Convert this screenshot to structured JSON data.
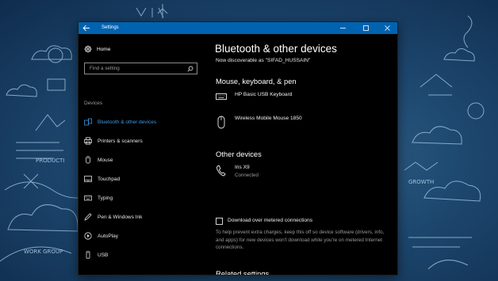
{
  "window": {
    "title": "Settings",
    "back_icon": "back-arrow-icon",
    "controls": [
      "minimize-icon",
      "maximize-icon",
      "close-icon"
    ],
    "accent_color": "#0063b1"
  },
  "sidebar": {
    "home_label": "Home",
    "search_placeholder": "Find a setting",
    "section_label": "Devices",
    "items": [
      {
        "label": "Bluetooth & other devices",
        "icon": "bluetooth-devices-icon",
        "active": true
      },
      {
        "label": "Printers & scanners",
        "icon": "printer-icon",
        "active": false
      },
      {
        "label": "Mouse",
        "icon": "mouse-icon",
        "active": false
      },
      {
        "label": "Touchpad",
        "icon": "touchpad-icon",
        "active": false
      },
      {
        "label": "Typing",
        "icon": "keyboard-icon",
        "active": false
      },
      {
        "label": "Pen & Windows Ink",
        "icon": "pen-icon",
        "active": false
      },
      {
        "label": "AutoPlay",
        "icon": "autoplay-icon",
        "active": false
      },
      {
        "label": "USB",
        "icon": "usb-icon",
        "active": false
      }
    ],
    "active_color": "#3e98e0"
  },
  "main": {
    "title": "Bluetooth & other devices",
    "discoverable": "Now discoverable as \"SIFAD_HUSSAIN\"",
    "sections": {
      "input": {
        "heading": "Mouse, keyboard, & pen",
        "devices": [
          {
            "name": "HP Basic USB Keyboard",
            "icon": "keyboard-icon"
          },
          {
            "name": "Wireless Mobile Mouse 1850",
            "icon": "mouse-icon"
          }
        ]
      },
      "other": {
        "heading": "Other devices",
        "devices": [
          {
            "name": "Iris X9",
            "status": "Connected",
            "icon": "phone-icon"
          }
        ]
      }
    },
    "metered": {
      "checkbox_label": "Download over metered connections",
      "checked": false,
      "help": "To help prevent extra charges, keep this off so device software (drivers, info, and apps) for new devices won't download while you're on metered Internet connections."
    },
    "related_heading": "Related settings"
  }
}
